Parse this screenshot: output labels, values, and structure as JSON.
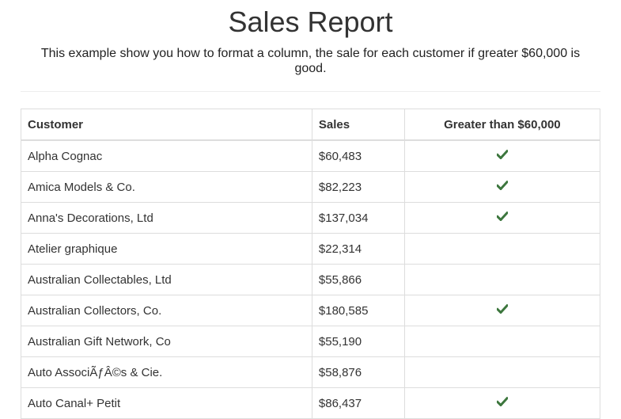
{
  "report": {
    "title": "Sales Report",
    "subtitle": "This example show you how to format a column, the sale for each customer if greater $60,000 is good."
  },
  "table": {
    "headers": {
      "customer": "Customer",
      "sales": "Sales",
      "flag": "Greater than $60,000"
    },
    "check_color": "#3c763d",
    "rows": [
      {
        "customer": "Alpha Cognac",
        "sales": "$60,483",
        "good": true
      },
      {
        "customer": "Amica Models & Co.",
        "sales": "$82,223",
        "good": true
      },
      {
        "customer": "Anna's Decorations, Ltd",
        "sales": "$137,034",
        "good": true
      },
      {
        "customer": "Atelier graphique",
        "sales": "$22,314",
        "good": false
      },
      {
        "customer": "Australian Collectables, Ltd",
        "sales": "$55,866",
        "good": false
      },
      {
        "customer": "Australian Collectors, Co.",
        "sales": "$180,585",
        "good": true
      },
      {
        "customer": "Australian Gift Network, Co",
        "sales": "$55,190",
        "good": false
      },
      {
        "customer": "Auto AssociÃƒÂ©s & Cie.",
        "sales": "$58,876",
        "good": false
      },
      {
        "customer": "Auto Canal+ Petit",
        "sales": "$86,437",
        "good": true
      }
    ]
  }
}
